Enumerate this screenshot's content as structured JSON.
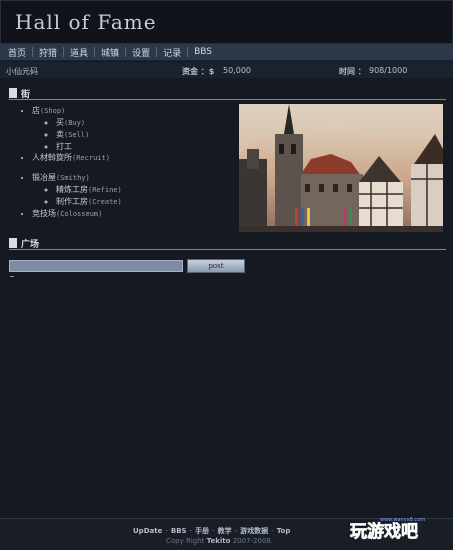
{
  "header": {
    "title": "Hall of Fame"
  },
  "nav": {
    "items": [
      "首页",
      "狩猎",
      "道具",
      "城镇",
      "设置",
      "记录",
      "BBS"
    ]
  },
  "status": {
    "player": "小仙元码",
    "money_label": "资金 ：$",
    "money_value": "50,000",
    "time_label": "时间 ：",
    "time_value": "908/1000"
  },
  "town": {
    "section_title": "街",
    "shop": {
      "label": "店",
      "en": "(Shop)"
    },
    "buy": {
      "label": "买",
      "en": "(Buy)"
    },
    "sell": {
      "label": "卖",
      "en": "(Sell)"
    },
    "work": {
      "label": "打工"
    },
    "recruit": {
      "label": "人材斡旋所",
      "en": "(Recruit)"
    },
    "smithy": {
      "label": "锻冶屋",
      "en": "(Smithy)"
    },
    "refine": {
      "label": "精炼工房",
      "en": "(Refine)"
    },
    "create": {
      "label": "制作工房",
      "en": "(Create)"
    },
    "colosseum": {
      "label": "竞技场",
      "en": "(Colosseum)"
    }
  },
  "plaza": {
    "section_title": "广场",
    "input_value": "",
    "post_label": "post"
  },
  "footer": {
    "links": [
      "UpDate",
      "BBS",
      "手册",
      "教学",
      "游戏数据",
      "Top"
    ],
    "copy_prefix": "Copy Right",
    "copy_author": "Tekito",
    "copy_years": "2007-2008."
  },
  "watermark": {
    "text": "玩游戏吧",
    "url": "www.wanyx8.com"
  },
  "colors": {
    "background": "#141922",
    "nav": "#2c3849",
    "accent": "#d8dce4"
  }
}
